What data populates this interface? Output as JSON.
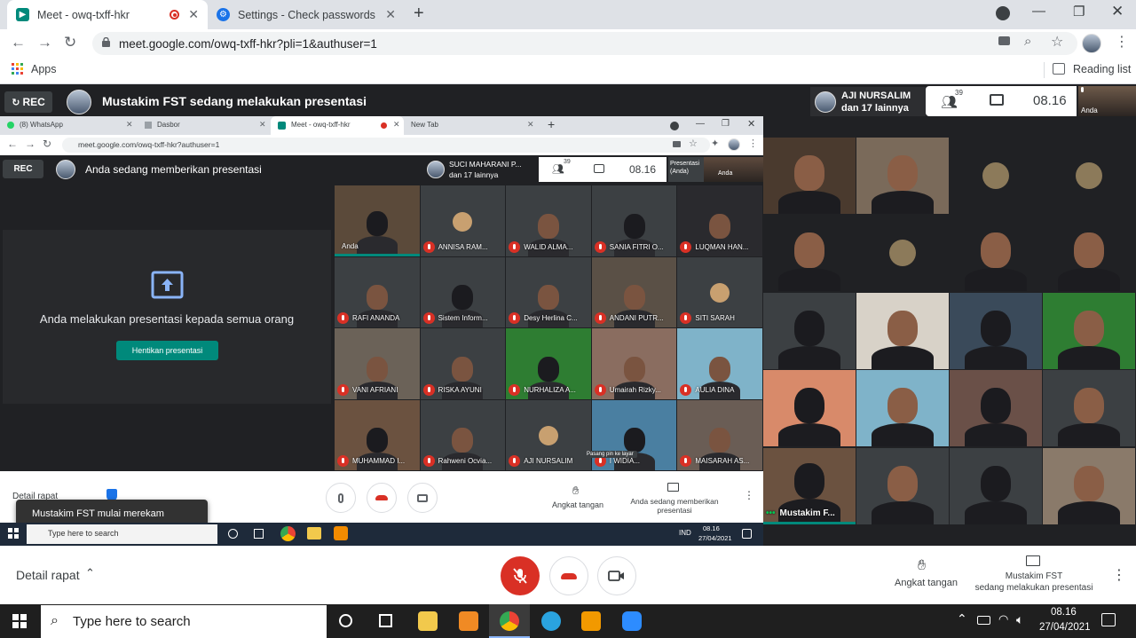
{
  "browser": {
    "tabs": [
      {
        "label": "Meet - owq-txff-hkr"
      },
      {
        "label": "Settings - Check passwords"
      }
    ],
    "url": "meet.google.com/owq-txff-hkr?pli=1&authuser=1",
    "bookmarks_apps": "Apps",
    "reading_list": "Reading list"
  },
  "meet": {
    "rec_label": "REC",
    "presenting_title": "Mustakim FST sedang melakukan presentasi",
    "top_participant_name": "AJI NURSALIM",
    "top_participant_others": "dan 17 lainnya",
    "people_count": "39",
    "clock": "08.16",
    "self_label": "Anda",
    "bottom": {
      "details_label": "Detail rapat",
      "raise_hand_label": "Angkat tangan",
      "presenter_line1": "Mustakim FST",
      "presenter_line2": "sedang melakukan presentasi"
    }
  },
  "shared_screen": {
    "tabs": [
      {
        "label": "(8) WhatsApp"
      },
      {
        "label": "Dasbor"
      },
      {
        "label": "Meet - owq-txff-hkr"
      },
      {
        "label": "New Tab"
      }
    ],
    "url": "meet.google.com/owq-txff-hkr?authuser=1",
    "rec_label": "REC",
    "presenting_title": "Anda sedang memberikan presentasi",
    "top_participant_name": "SUCI MAHARANI P...",
    "top_participant_others": "dan 17 lainnya",
    "people_count": "39",
    "clock": "08.16",
    "presenter_tile": "Presentasi (Anda)",
    "self_label": "Anda",
    "present_message": "Anda melakukan presentasi kepada semua orang",
    "stop_button": "Hentikan presentasi",
    "details_label": "Detail rapat",
    "toast": "Mustakim FST mulai merekam",
    "raise_hand_label": "Angkat tangan",
    "presenting_label": "Anda sedang memberikan presentasi",
    "pin_tooltip": "Pasang pin ke layar",
    "taskbar_search": "Type here to search",
    "tray_lang": "IND",
    "tray_time": "08.16",
    "tray_date": "27/04/2021",
    "tiles": [
      {
        "name": "Anda"
      },
      {
        "name": "ANNISA RAM..."
      },
      {
        "name": "WALID ALMA..."
      },
      {
        "name": "SANIA FITRI O..."
      },
      {
        "name": "LUQMAN HAN..."
      },
      {
        "name": "RAFI ANANDA"
      },
      {
        "name": "Sistem Inform..."
      },
      {
        "name": "Desy Herlina C..."
      },
      {
        "name": "ANDANI PUTR..."
      },
      {
        "name": "SITI SARAH"
      },
      {
        "name": "VANI AFRIANI"
      },
      {
        "name": "RISKA AYUNI"
      },
      {
        "name": "NURHALIZA A..."
      },
      {
        "name": "Umairah Rizky..."
      },
      {
        "name": "AULIA DINA"
      },
      {
        "name": "MUHAMMAD I..."
      },
      {
        "name": "Rahweni Ocvia..."
      },
      {
        "name": "AJI NURSALIM"
      },
      {
        "name": "I WIDIA..."
      },
      {
        "name": "MAISARAH AS..."
      }
    ]
  },
  "right_grid": {
    "self_tile_name": "Mustakim F..."
  },
  "taskbar": {
    "search_placeholder": "Type here to search",
    "time": "08.16",
    "date": "27/04/2021"
  },
  "colors": {
    "danger": "#d93025",
    "meet_bg": "#202124",
    "accent_teal": "#00897b"
  }
}
